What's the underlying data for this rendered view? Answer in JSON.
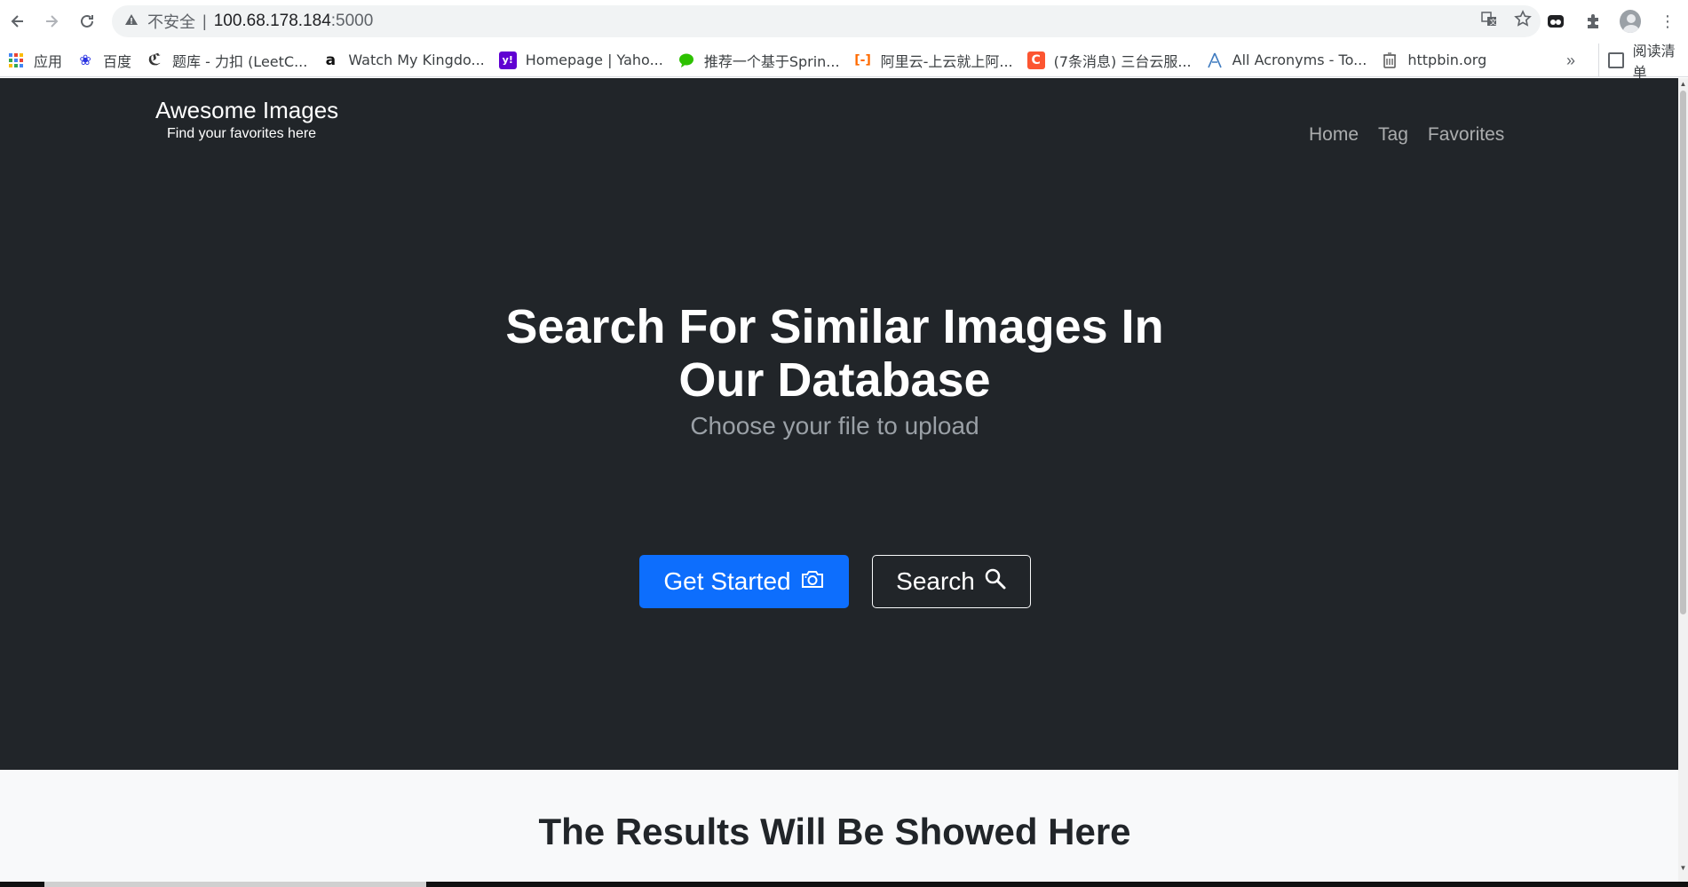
{
  "browser": {
    "url_security": "不安全",
    "url_separator": "|",
    "url_host": "100.68.178.184",
    "url_port": ":5000",
    "icons": {
      "back": "arrow-left-icon",
      "forward": "arrow-right-icon",
      "reload": "reload-icon",
      "warning": "warning-icon",
      "translate": "translate-icon",
      "bookmark": "star-icon",
      "extension1": "extension-icon",
      "puzzle": "puzzle-icon",
      "profile": "avatar-icon",
      "menu": "kebab-menu-icon"
    }
  },
  "bookmarks": [
    {
      "label": "应用",
      "icon": "apps-grid-icon"
    },
    {
      "label": "百度",
      "icon": "baidu-icon"
    },
    {
      "label": "题库 - 力扣 (LeetC...",
      "icon": "leetcode-icon"
    },
    {
      "label": "Watch My Kingdo...",
      "icon": "amazon-icon"
    },
    {
      "label": "Homepage | Yaho...",
      "icon": "yahoo-icon"
    },
    {
      "label": "推荐一个基于Sprin...",
      "icon": "wechat-icon"
    },
    {
      "label": "阿里云-上云就上阿...",
      "icon": "aliyun-icon"
    },
    {
      "label": "(7条消息) 三台云服...",
      "icon": "csdn-icon"
    },
    {
      "label": "All Acronyms - To...",
      "icon": "acronyms-icon"
    },
    {
      "label": "httpbin.org",
      "icon": "httpbin-icon"
    }
  ],
  "bookmarks_more": "»",
  "reading_list": "阅读清单",
  "site": {
    "brand_name": "Awesome Images",
    "brand_tagline": "Find your favorites here",
    "nav": [
      "Home",
      "Tag",
      "Favorites"
    ],
    "hero_title_line1": "Search For Similar Images In",
    "hero_title_line2": "Our Database",
    "hero_subtitle": "Choose your file to upload",
    "primary_button": "Get Started",
    "secondary_button": "Search",
    "results_title": "The Results Will Be Showed Here"
  },
  "colors": {
    "hero_bg": "#212529",
    "primary": "#0d6efd",
    "results_bg": "#f8f9fa"
  }
}
